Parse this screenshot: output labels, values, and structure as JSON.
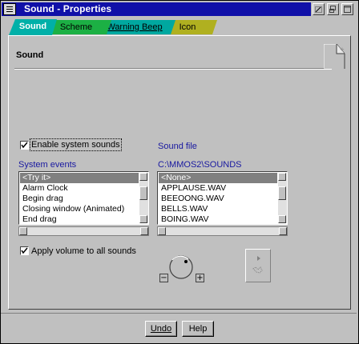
{
  "window": {
    "title": "Sound - Properties"
  },
  "tabs": [
    {
      "label": "Sound",
      "active": true
    },
    {
      "label": "Scheme",
      "active": false
    },
    {
      "label": "Warning Beep",
      "active": false
    },
    {
      "label": "Icon",
      "active": false
    }
  ],
  "page": {
    "title": "Sound"
  },
  "enable_sounds": {
    "label": "Enable system sounds",
    "checked": true
  },
  "events": {
    "label": "System events",
    "items": [
      "<Try it>",
      "Alarm Clock",
      "Begin drag",
      "Closing window (Animated)",
      "End drag"
    ],
    "selected_index": 0
  },
  "sound_file": {
    "label": "Sound file",
    "path": "C:\\MMOS2\\SOUNDS",
    "items": [
      "<None>",
      "APPLAUSE.WAV",
      "BEEOONG.WAV",
      "BELLS.WAV",
      "BOING.WAV"
    ],
    "selected_index": 0
  },
  "apply_volume": {
    "label": "Apply volume to all sounds",
    "checked": true
  },
  "volume": {
    "minus": "−",
    "plus": "+"
  },
  "buttons": {
    "undo": "Undo",
    "help": "Help"
  },
  "colors": {
    "titlebar": "#1010a8",
    "tab_sound": "#00b0a8",
    "tab_scheme": "#1cb044",
    "tab_beep": "#00a8a0",
    "tab_icon": "#b0b020",
    "label_blue": "#1818a0",
    "selection": "#808080"
  }
}
